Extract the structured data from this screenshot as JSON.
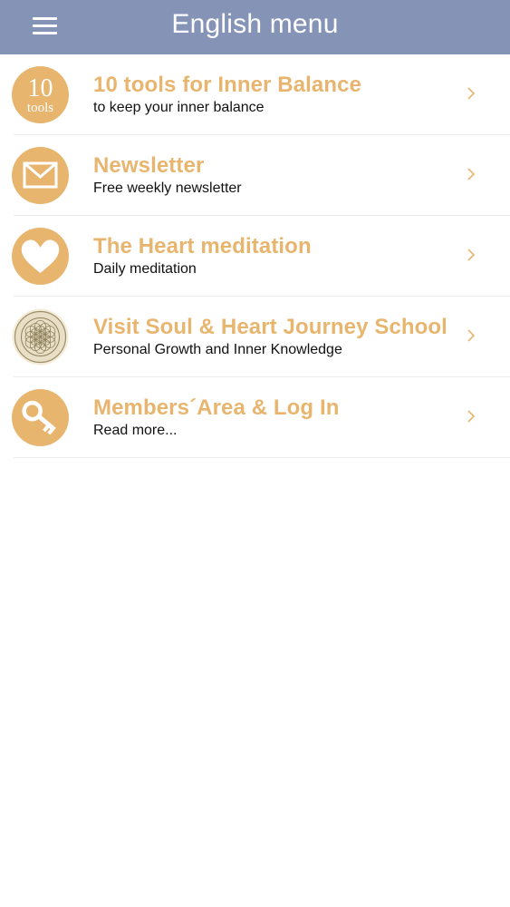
{
  "header": {
    "title": "English menu",
    "menu_icon": "hamburger-menu-icon",
    "background": "#8593b6"
  },
  "colors": {
    "accent": "#e8b56f",
    "subtitle": "#111111",
    "chevron": "#e8b56f",
    "divider": "#ececec"
  },
  "menu": {
    "items": [
      {
        "title": "10 tools for Inner Balance",
        "subtitle": "to keep your inner balance",
        "icon": "ten-tools-icon",
        "icon_number": "10",
        "icon_word": "tools"
      },
      {
        "title": "Newsletter",
        "subtitle": "Free weekly newsletter",
        "icon": "envelope-icon"
      },
      {
        "title": "The Heart meditation",
        "subtitle": "Daily meditation",
        "icon": "heart-icon"
      },
      {
        "title": "Visit Soul & Heart Journey School",
        "subtitle": "Personal Growth and Inner Knowledge",
        "icon": "flower-of-life-icon"
      },
      {
        "title": "Members´Area & Log In",
        "subtitle": "Read more...",
        "icon": "key-icon"
      }
    ]
  }
}
